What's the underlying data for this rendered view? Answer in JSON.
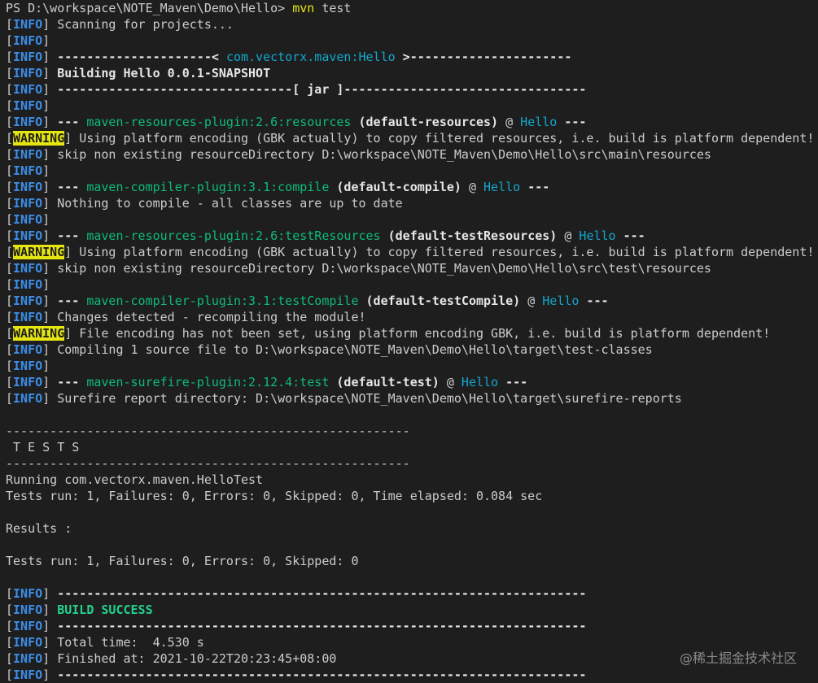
{
  "terminal": {
    "lines": [
      [
        {
          "t": "PS D:\\workspace\\NOTE_Maven\\Demo\\Hello> ",
          "s": "plain"
        },
        {
          "t": "mvn",
          "s": "yellow"
        },
        {
          "t": " test",
          "s": "plain"
        }
      ],
      [
        {
          "t": "[",
          "s": "plain"
        },
        {
          "t": "INFO",
          "s": "info"
        },
        {
          "t": "] Scanning for projects...",
          "s": "plain"
        }
      ],
      [
        {
          "t": "[",
          "s": "plain"
        },
        {
          "t": "INFO",
          "s": "info"
        },
        {
          "t": "]",
          "s": "plain"
        }
      ],
      [
        {
          "t": "[",
          "s": "plain"
        },
        {
          "t": "INFO",
          "s": "info"
        },
        {
          "t": "] ",
          "s": "plain"
        },
        {
          "t": "---------------------< ",
          "s": "bold"
        },
        {
          "t": "com.vectorx.maven:Hello",
          "s": "cyan"
        },
        {
          "t": " >----------------------",
          "s": "bold"
        }
      ],
      [
        {
          "t": "[",
          "s": "plain"
        },
        {
          "t": "INFO",
          "s": "info"
        },
        {
          "t": "] ",
          "s": "plain"
        },
        {
          "t": "Building Hello 0.0.1-SNAPSHOT",
          "s": "bold"
        }
      ],
      [
        {
          "t": "[",
          "s": "plain"
        },
        {
          "t": "INFO",
          "s": "info"
        },
        {
          "t": "] ",
          "s": "plain"
        },
        {
          "t": "--------------------------------[ jar ]---------------------------------",
          "s": "bold"
        }
      ],
      [
        {
          "t": "[",
          "s": "plain"
        },
        {
          "t": "INFO",
          "s": "info"
        },
        {
          "t": "]",
          "s": "plain"
        }
      ],
      [
        {
          "t": "[",
          "s": "plain"
        },
        {
          "t": "INFO",
          "s": "info"
        },
        {
          "t": "] ",
          "s": "plain"
        },
        {
          "t": "--- ",
          "s": "bold"
        },
        {
          "t": "maven-resources-plugin:2.6:resources",
          "s": "plugin"
        },
        {
          "t": " (default-resources)",
          "s": "bold"
        },
        {
          "t": " @ ",
          "s": "plain"
        },
        {
          "t": "Hello",
          "s": "cyan"
        },
        {
          "t": " ---",
          "s": "bold"
        }
      ],
      [
        {
          "t": "[",
          "s": "plain"
        },
        {
          "t": "WARNING",
          "s": "warn"
        },
        {
          "t": "] Using platform encoding (GBK actually) to copy filtered resources, i.e. build is platform dependent!",
          "s": "plain"
        }
      ],
      [
        {
          "t": "[",
          "s": "plain"
        },
        {
          "t": "INFO",
          "s": "info"
        },
        {
          "t": "] skip non existing resourceDirectory D:\\workspace\\NOTE_Maven\\Demo\\Hello\\src\\main\\resources",
          "s": "plain"
        }
      ],
      [
        {
          "t": "[",
          "s": "plain"
        },
        {
          "t": "INFO",
          "s": "info"
        },
        {
          "t": "]",
          "s": "plain"
        }
      ],
      [
        {
          "t": "[",
          "s": "plain"
        },
        {
          "t": "INFO",
          "s": "info"
        },
        {
          "t": "] ",
          "s": "plain"
        },
        {
          "t": "--- ",
          "s": "bold"
        },
        {
          "t": "maven-compiler-plugin:3.1:compile",
          "s": "plugin"
        },
        {
          "t": " (default-compile)",
          "s": "bold"
        },
        {
          "t": " @ ",
          "s": "plain"
        },
        {
          "t": "Hello",
          "s": "cyan"
        },
        {
          "t": " ---",
          "s": "bold"
        }
      ],
      [
        {
          "t": "[",
          "s": "plain"
        },
        {
          "t": "INFO",
          "s": "info"
        },
        {
          "t": "] Nothing to compile - all classes are up to date",
          "s": "plain"
        }
      ],
      [
        {
          "t": "[",
          "s": "plain"
        },
        {
          "t": "INFO",
          "s": "info"
        },
        {
          "t": "]",
          "s": "plain"
        }
      ],
      [
        {
          "t": "[",
          "s": "plain"
        },
        {
          "t": "INFO",
          "s": "info"
        },
        {
          "t": "] ",
          "s": "plain"
        },
        {
          "t": "--- ",
          "s": "bold"
        },
        {
          "t": "maven-resources-plugin:2.6:testResources",
          "s": "plugin"
        },
        {
          "t": " (default-testResources)",
          "s": "bold"
        },
        {
          "t": " @ ",
          "s": "plain"
        },
        {
          "t": "Hello",
          "s": "cyan"
        },
        {
          "t": " ---",
          "s": "bold"
        }
      ],
      [
        {
          "t": "[",
          "s": "plain"
        },
        {
          "t": "WARNING",
          "s": "warn"
        },
        {
          "t": "] Using platform encoding (GBK actually) to copy filtered resources, i.e. build is platform dependent!",
          "s": "plain"
        }
      ],
      [
        {
          "t": "[",
          "s": "plain"
        },
        {
          "t": "INFO",
          "s": "info"
        },
        {
          "t": "] skip non existing resourceDirectory D:\\workspace\\NOTE_Maven\\Demo\\Hello\\src\\test\\resources",
          "s": "plain"
        }
      ],
      [
        {
          "t": "[",
          "s": "plain"
        },
        {
          "t": "INFO",
          "s": "info"
        },
        {
          "t": "]",
          "s": "plain"
        }
      ],
      [
        {
          "t": "[",
          "s": "plain"
        },
        {
          "t": "INFO",
          "s": "info"
        },
        {
          "t": "] ",
          "s": "plain"
        },
        {
          "t": "--- ",
          "s": "bold"
        },
        {
          "t": "maven-compiler-plugin:3.1:testCompile",
          "s": "plugin"
        },
        {
          "t": " (default-testCompile)",
          "s": "bold"
        },
        {
          "t": " @ ",
          "s": "plain"
        },
        {
          "t": "Hello",
          "s": "cyan"
        },
        {
          "t": " ---",
          "s": "bold"
        }
      ],
      [
        {
          "t": "[",
          "s": "plain"
        },
        {
          "t": "INFO",
          "s": "info"
        },
        {
          "t": "] Changes detected - recompiling the module!",
          "s": "plain"
        }
      ],
      [
        {
          "t": "[",
          "s": "plain"
        },
        {
          "t": "WARNING",
          "s": "warn"
        },
        {
          "t": "] File encoding has not been set, using platform encoding GBK, i.e. build is platform dependent!",
          "s": "plain"
        }
      ],
      [
        {
          "t": "[",
          "s": "plain"
        },
        {
          "t": "INFO",
          "s": "info"
        },
        {
          "t": "] Compiling 1 source file to D:\\workspace\\NOTE_Maven\\Demo\\Hello\\target\\test-classes",
          "s": "plain"
        }
      ],
      [
        {
          "t": "[",
          "s": "plain"
        },
        {
          "t": "INFO",
          "s": "info"
        },
        {
          "t": "]",
          "s": "plain"
        }
      ],
      [
        {
          "t": "[",
          "s": "plain"
        },
        {
          "t": "INFO",
          "s": "info"
        },
        {
          "t": "] ",
          "s": "plain"
        },
        {
          "t": "--- ",
          "s": "bold"
        },
        {
          "t": "maven-surefire-plugin:2.12.4:test",
          "s": "plugin"
        },
        {
          "t": " (default-test)",
          "s": "bold"
        },
        {
          "t": " @ ",
          "s": "plain"
        },
        {
          "t": "Hello",
          "s": "cyan"
        },
        {
          "t": " ---",
          "s": "bold"
        }
      ],
      [
        {
          "t": "[",
          "s": "plain"
        },
        {
          "t": "INFO",
          "s": "info"
        },
        {
          "t": "] Surefire report directory: D:\\workspace\\NOTE_Maven\\Demo\\Hello\\target\\surefire-reports",
          "s": "plain"
        }
      ],
      [],
      [
        {
          "t": "-------------------------------------------------------",
          "s": "plain"
        }
      ],
      [
        {
          "t": " T E S T S",
          "s": "plain"
        }
      ],
      [
        {
          "t": "-------------------------------------------------------",
          "s": "plain"
        }
      ],
      [
        {
          "t": "Running com.vectorx.maven.HelloTest",
          "s": "plain"
        }
      ],
      [
        {
          "t": "Tests run: 1, Failures: 0, Errors: 0, Skipped: 0, Time elapsed: 0.084 sec",
          "s": "plain"
        }
      ],
      [],
      [
        {
          "t": "Results :",
          "s": "plain"
        }
      ],
      [],
      [
        {
          "t": "Tests run: 1, Failures: 0, Errors: 0, Skipped: 0",
          "s": "plain"
        }
      ],
      [],
      [
        {
          "t": "[",
          "s": "plain"
        },
        {
          "t": "INFO",
          "s": "info"
        },
        {
          "t": "] ",
          "s": "plain"
        },
        {
          "t": "------------------------------------------------------------------------",
          "s": "bold"
        }
      ],
      [
        {
          "t": "[",
          "s": "plain"
        },
        {
          "t": "INFO",
          "s": "info"
        },
        {
          "t": "] ",
          "s": "plain"
        },
        {
          "t": "BUILD SUCCESS",
          "s": "success"
        }
      ],
      [
        {
          "t": "[",
          "s": "plain"
        },
        {
          "t": "INFO",
          "s": "info"
        },
        {
          "t": "] ",
          "s": "plain"
        },
        {
          "t": "------------------------------------------------------------------------",
          "s": "bold"
        }
      ],
      [
        {
          "t": "[",
          "s": "plain"
        },
        {
          "t": "INFO",
          "s": "info"
        },
        {
          "t": "] Total time:  4.530 s",
          "s": "plain"
        }
      ],
      [
        {
          "t": "[",
          "s": "plain"
        },
        {
          "t": "INFO",
          "s": "info"
        },
        {
          "t": "] Finished at: 2021-10-22T20:23:45+08:00",
          "s": "plain"
        }
      ],
      [
        {
          "t": "[",
          "s": "plain"
        },
        {
          "t": "INFO",
          "s": "info"
        },
        {
          "t": "] ",
          "s": "plain"
        },
        {
          "t": "------------------------------------------------------------------------",
          "s": "bold"
        }
      ]
    ]
  },
  "watermark": {
    "text": "@稀土掘金技术社区"
  },
  "colors": {
    "background": "#1e1e1e",
    "foreground": "#cccccc",
    "info": "#3b8eea",
    "warning_bg": "#e5e510",
    "plugin": "#0dbc79",
    "artifact": "#11a8cd",
    "command": "#e5e510",
    "success": "#23d18b"
  }
}
